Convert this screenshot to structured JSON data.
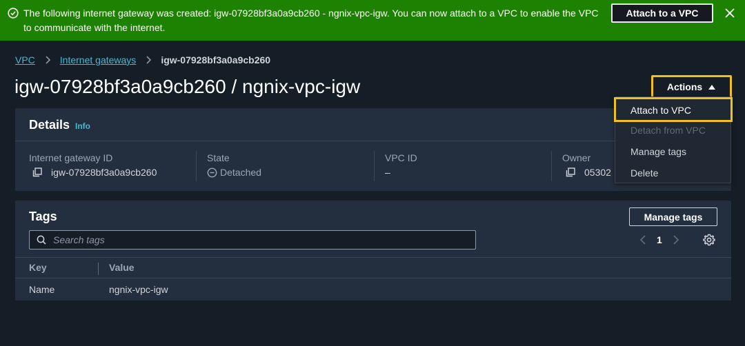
{
  "flash": {
    "message": "The following internet gateway was created: igw-07928bf3a0a9cb260 - ngnix-vpc-igw. You can now attach to a VPC to enable the VPC to communicate with the internet.",
    "attach_button": "Attach to a VPC",
    "icons": {
      "status": "check-circle-icon",
      "close": "close-icon"
    },
    "color": "#1d8102"
  },
  "breadcrumb": {
    "items": [
      "VPC",
      "Internet gateways"
    ],
    "current": "igw-07928bf3a0a9cb260"
  },
  "page": {
    "title": "igw-07928bf3a0a9cb260 / ngnix-vpc-igw"
  },
  "actions": {
    "label": "Actions",
    "menu": [
      {
        "label": "Attach to VPC",
        "enabled": true
      },
      {
        "label": "Detach from VPC",
        "enabled": false
      },
      {
        "label": "Manage tags",
        "enabled": true
      },
      {
        "label": "Delete",
        "enabled": true
      }
    ],
    "highlight_color": "#f2c01d"
  },
  "details": {
    "title": "Details",
    "info_link": "Info",
    "fields": [
      {
        "label": "Internet gateway ID",
        "value": "igw-07928bf3a0a9cb260"
      },
      {
        "label": "State",
        "value": "Detached"
      },
      {
        "label": "VPC ID",
        "value": "–"
      },
      {
        "label": "Owner",
        "value": "05302"
      }
    ]
  },
  "tags": {
    "title": "Tags",
    "manage_button": "Manage tags",
    "search_placeholder": "Search tags",
    "page_number": "1",
    "columns": [
      "Key",
      "Value"
    ],
    "rows": [
      {
        "key": "Name",
        "value": "ngnix-vpc-igw"
      }
    ]
  }
}
